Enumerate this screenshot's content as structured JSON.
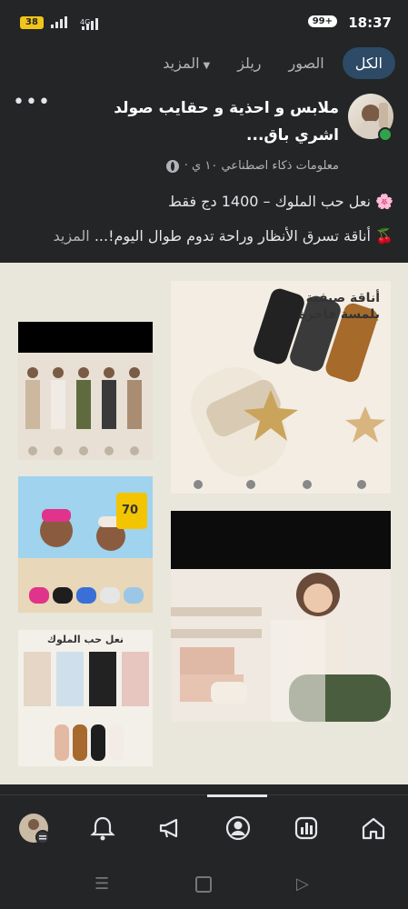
{
  "status_bar": {
    "time": "18:37",
    "notification_badge": "99+",
    "battery": "38",
    "network_label": "4G"
  },
  "tabs": [
    {
      "label": "الكل",
      "active": true
    },
    {
      "label": "الصور",
      "active": false
    },
    {
      "label": "ريلز",
      "active": false
    },
    {
      "label": "المزيد",
      "active": false
    }
  ],
  "post": {
    "title": "ملابس و احذية و حقايب صولد اشري باق...",
    "meta": "معلومات ذكاء اصطناعي ١٠ ي ·",
    "line1": "🌸 نعل حب الملوك – 1400 دج فقط",
    "line2": "🍒 أناقة تسرق الأنظار وراحة تدوم طوال اليوم!...",
    "more": "المزيد"
  },
  "images": {
    "main1_title": "أناقة صيفية بلمسة فاخرة",
    "s2_promo": "70",
    "s3_title": "نعل حب الملوك"
  },
  "colors": {
    "background": "#242526",
    "active_tab": "#2d4a66",
    "online_dot": "#31a24c",
    "grid_bg": "#e9e6db"
  }
}
